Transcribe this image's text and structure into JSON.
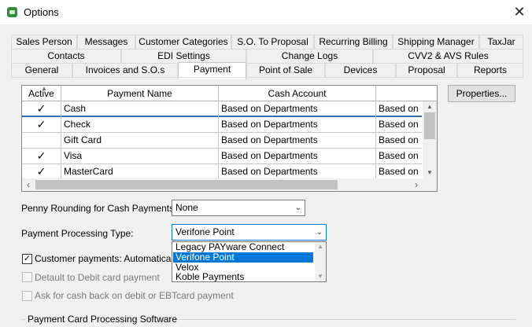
{
  "window": {
    "title": "Options",
    "close_glyph": "✕"
  },
  "tabs": {
    "row1": [
      "Sales Person",
      "Messages",
      "Customer Categories",
      "S.O. To Proposal",
      "Recurring Billing",
      "Shipping Manager",
      "TaxJar"
    ],
    "row2": [
      "Contacts",
      "EDI Settings",
      "Change Logs",
      "CVV2 & AVS Rules"
    ],
    "row3": [
      "General",
      "Invoices and S.O.s",
      "Payment",
      "Point of Sale",
      "Devices",
      "Proposal",
      "Reports"
    ],
    "active": "Payment"
  },
  "payments_grid": {
    "columns": [
      "Active",
      "Payment Name",
      "Cash Account",
      "Based on De"
    ],
    "sort_glyph": "▲",
    "rows": [
      {
        "active": "✓",
        "name": "Cash",
        "account": "Based on Departments",
        "extra": "Based on De"
      },
      {
        "active": "✓",
        "name": "Check",
        "account": "Based on Departments",
        "extra": "Based on De"
      },
      {
        "active": "",
        "name": "Gift Card",
        "account": "Based on Departments",
        "extra": "Based on De"
      },
      {
        "active": "✓",
        "name": "Visa",
        "account": "Based on Departments",
        "extra": "Based on De"
      },
      {
        "active": "✓",
        "name": "MasterCard",
        "account": "Based on Departments",
        "extra": "Based on De"
      }
    ],
    "scroll_glyphs": {
      "up": "▲",
      "down": "▼",
      "left": "‹",
      "right": "›"
    }
  },
  "properties_button": {
    "label": "Properties..."
  },
  "penny_rounding": {
    "label": "Penny Rounding for Cash Payments:",
    "value": "None"
  },
  "processing_type": {
    "label": "Payment Processing Type:",
    "value": "Verifone Point",
    "options": [
      "Legacy PAYware Connect",
      "Verifone Point",
      "Velox",
      "Koble Payments"
    ],
    "selected": "Verifone Point"
  },
  "checkboxes": [
    {
      "label": "Customer payments: Automatically dis",
      "checked": true,
      "enabled": true
    },
    {
      "label": "Detault to Debit card payment",
      "checked": false,
      "enabled": false
    },
    {
      "label": "Ask for cash back on debit or EBTcard payment",
      "checked": false,
      "enabled": false
    }
  ],
  "group_title": "Payment Card Processing Software",
  "icons": {
    "app": "app-icon",
    "chevron": "⌄"
  }
}
